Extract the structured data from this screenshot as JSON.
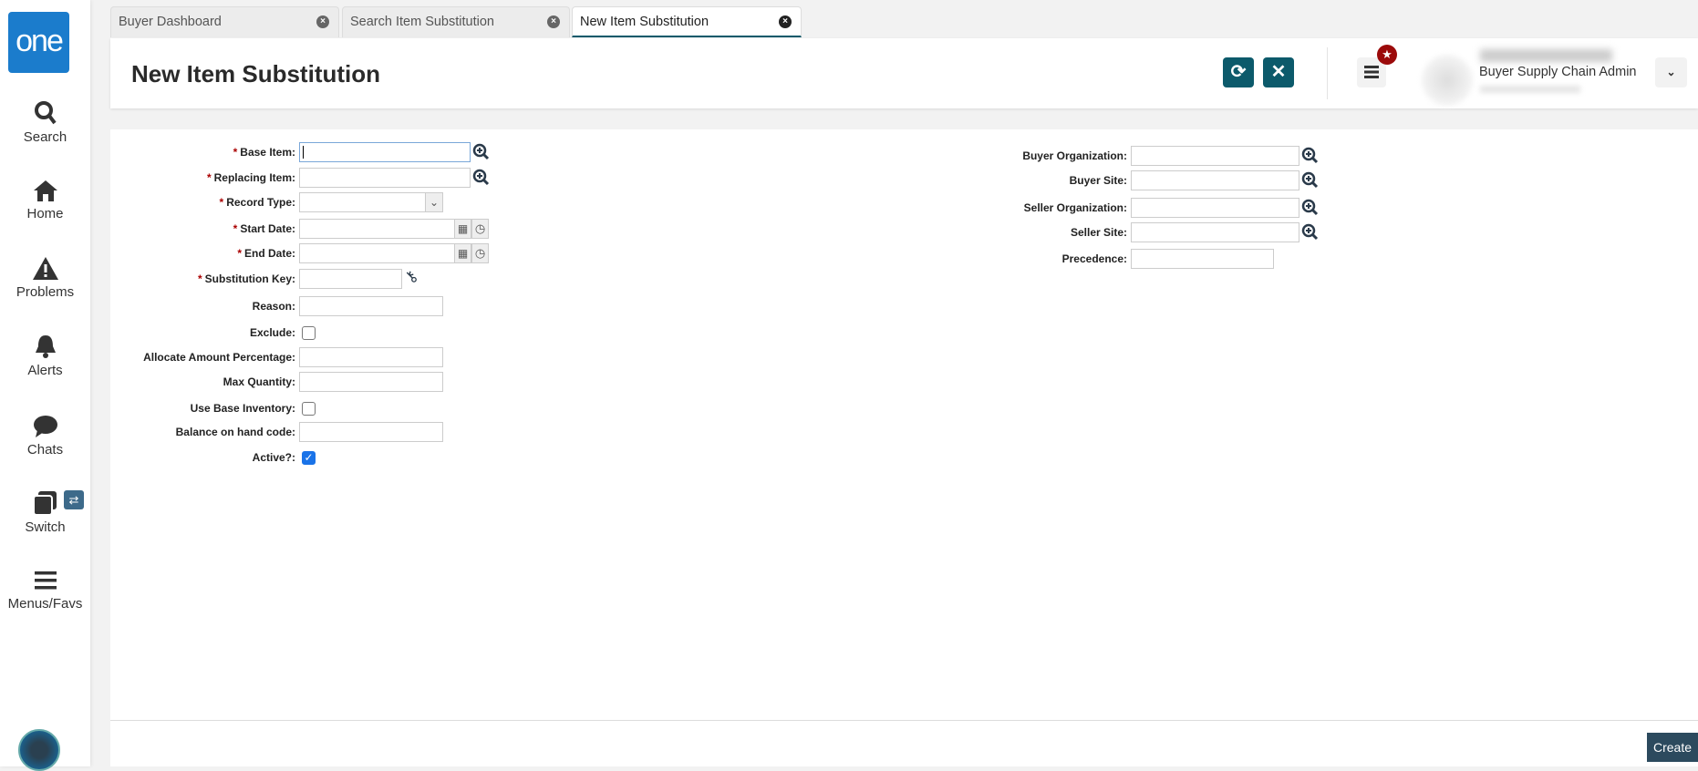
{
  "sidebar": {
    "logo": "one",
    "items": [
      {
        "label": "Search",
        "icon": "search-icon"
      },
      {
        "label": "Home",
        "icon": "home-icon"
      },
      {
        "label": "Problems",
        "icon": "warning-icon"
      },
      {
        "label": "Alerts",
        "icon": "bell-icon"
      },
      {
        "label": "Chats",
        "icon": "chat-icon"
      },
      {
        "label": "Switch",
        "icon": "switch-icon"
      },
      {
        "label": "Menus/Favs",
        "icon": "menu-icon"
      }
    ]
  },
  "tabs": [
    {
      "label": "Buyer Dashboard"
    },
    {
      "label": "Search Item Substitution"
    },
    {
      "label": "New Item Substitution",
      "active": true
    }
  ],
  "header": {
    "title": "New Item Substitution",
    "user_role": "Buyer Supply Chain Admin"
  },
  "form_left": [
    {
      "label": "Base Item:",
      "required": true,
      "type": "lookup"
    },
    {
      "label": "Replacing Item:",
      "required": true,
      "type": "lookup"
    },
    {
      "label": "Record Type:",
      "required": true,
      "type": "select"
    },
    {
      "label": "Start Date:",
      "required": true,
      "type": "date"
    },
    {
      "label": "End Date:",
      "required": true,
      "type": "date"
    },
    {
      "label": "Substitution Key:",
      "required": true,
      "type": "key"
    },
    {
      "label": "Reason:",
      "type": "text"
    },
    {
      "label": "Exclude:",
      "type": "checkbox",
      "checked": false
    },
    {
      "label": "Allocate Amount Percentage:",
      "type": "text"
    },
    {
      "label": "Max Quantity:",
      "type": "text"
    },
    {
      "label": "Use Base Inventory:",
      "type": "checkbox",
      "checked": false
    },
    {
      "label": "Balance on hand code:",
      "type": "text"
    },
    {
      "label": "Active?:",
      "type": "checkbox",
      "checked": true
    }
  ],
  "form_right": [
    {
      "label": "Buyer Organization:",
      "type": "lookup"
    },
    {
      "label": "Buyer Site:",
      "type": "lookup"
    },
    {
      "label": "Seller Organization:",
      "type": "lookup"
    },
    {
      "label": "Seller Site:",
      "type": "lookup"
    },
    {
      "label": "Precedence:",
      "type": "text"
    }
  ],
  "footer": {
    "create_label": "Create"
  },
  "colors": {
    "accent": "#0c5a6b",
    "logo": "#1b7ccc",
    "required": "#aa0000"
  }
}
